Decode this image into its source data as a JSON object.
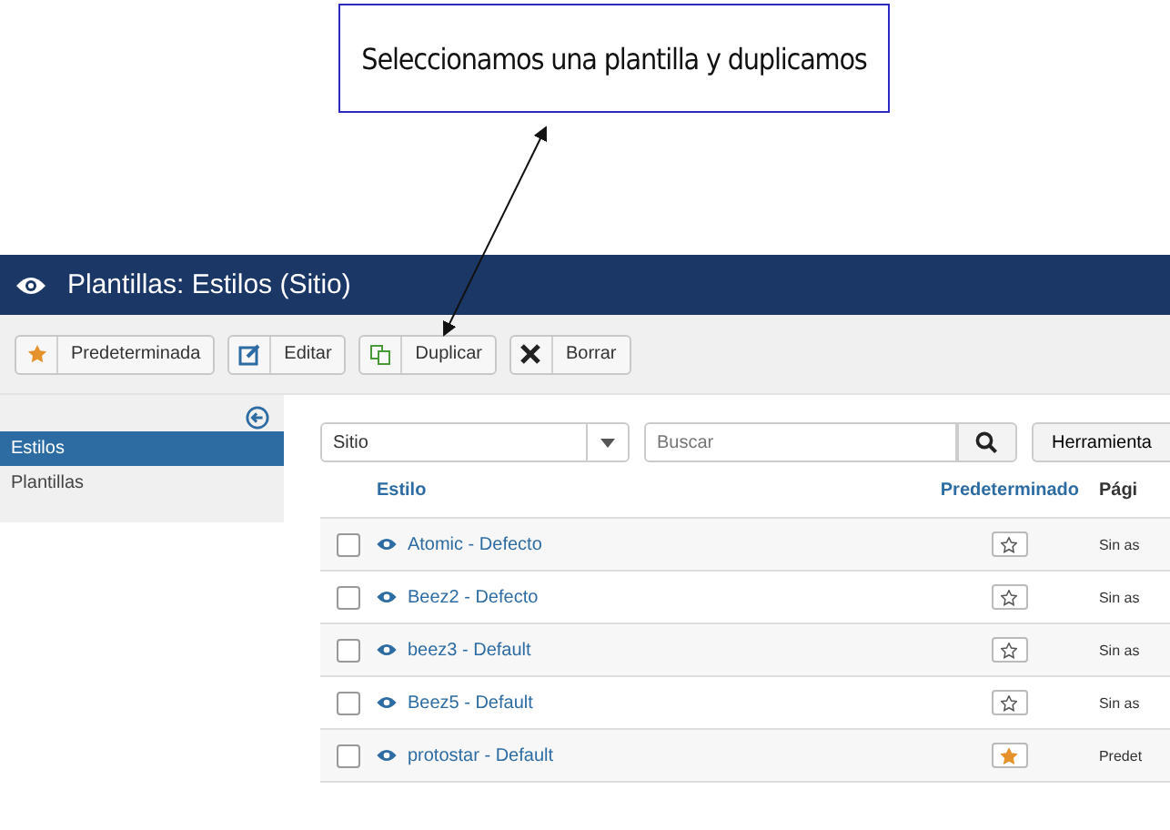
{
  "callout": {
    "text": "Seleccionamos una plantilla y duplicamos"
  },
  "header": {
    "title": "Plantillas: Estilos (Sitio)"
  },
  "toolbar": [
    {
      "label": "Predeterminada",
      "kind": "default"
    },
    {
      "label": "Editar",
      "kind": "edit"
    },
    {
      "label": "Duplicar",
      "kind": "duplicate"
    },
    {
      "label": "Borrar",
      "kind": "delete"
    }
  ],
  "sidebar": {
    "items": [
      {
        "label": "Estilos",
        "selected": true
      },
      {
        "label": "Plantillas",
        "selected": false
      }
    ]
  },
  "filters": {
    "location": "Sitio",
    "search_placeholder": "Buscar",
    "tools_button": "Herramienta"
  },
  "table": {
    "columns": [
      "Estilo",
      "Predeterminado",
      "Pági"
    ],
    "rows": [
      {
        "checked": false,
        "style": "Atomic - Defecto",
        "default": false,
        "pages": "Sin as"
      },
      {
        "checked": false,
        "style": "Beez2 - Defecto",
        "default": false,
        "pages": "Sin as"
      },
      {
        "checked": false,
        "style": "beez3 - Default",
        "default": false,
        "pages": "Sin as"
      },
      {
        "checked": false,
        "style": "Beez5 - Default",
        "default": false,
        "pages": "Sin as"
      },
      {
        "checked": false,
        "style": "protostar - Default",
        "default": true,
        "pages": "Predet"
      }
    ]
  }
}
